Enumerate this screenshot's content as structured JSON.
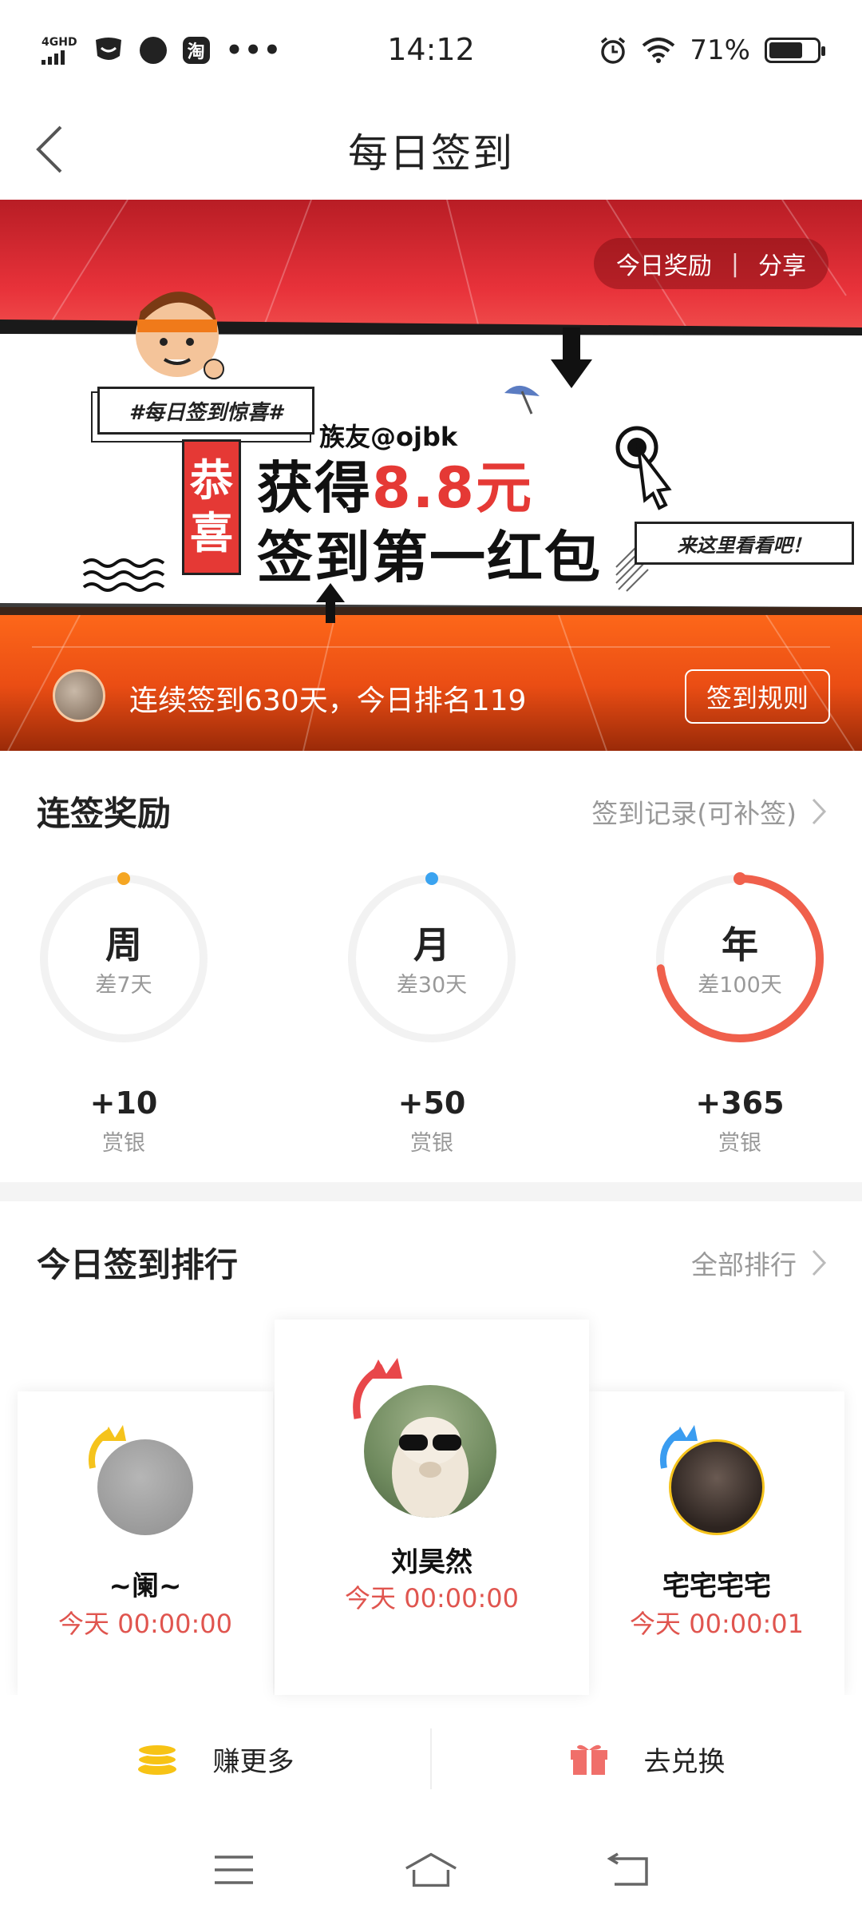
{
  "status_bar": {
    "network": "4GHD",
    "app_icon_text": "淘",
    "more": "•••",
    "time": "14:12",
    "battery": "71%",
    "battery_level": 0.71
  },
  "header": {
    "title": "每日签到"
  },
  "banner": {
    "reward_pill": {
      "today_reward": "今日奖励",
      "separator": "|",
      "share": "分享"
    },
    "tag": "#每日签到惊喜#",
    "congrats_chars": [
      "恭",
      "喜"
    ],
    "user": "族友@ojbk",
    "line1_prefix": "获得",
    "line1_amount": "8.8元",
    "line2": "签到第一红包",
    "come_see": "来这里看看吧！",
    "streak_text": "连续签到630天，今日排名119",
    "rules_button": "签到规则"
  },
  "streak_rewards": {
    "title": "连签奖励",
    "record_link": "签到记录(可补签)",
    "items": [
      {
        "label": "周",
        "remaining": "差7天",
        "reward": "+10",
        "unit": "赏银",
        "progress": 0.0,
        "dot_color": "#f5a623"
      },
      {
        "label": "月",
        "remaining": "差30天",
        "reward": "+50",
        "unit": "赏银",
        "progress": 0.0,
        "dot_color": "#3aa3f0"
      },
      {
        "label": "年",
        "remaining": "差100天",
        "reward": "+365",
        "unit": "赏银",
        "progress": 0.73,
        "dot_color": "#f0604c"
      }
    ]
  },
  "ranking": {
    "title": "今日签到排行",
    "all_link": "全部排行",
    "entries": [
      {
        "name": "刘昊然",
        "time": "今天 00:00:00",
        "crown_color": "#e8474a"
      },
      {
        "name": "~阑~",
        "time": "今天 00:00:00",
        "crown_color": "#f5c31c"
      },
      {
        "name": "宅宅宅宅",
        "time": "今天 00:00:01",
        "crown_color": "#3a9cf0"
      }
    ]
  },
  "bottom_actions": {
    "earn_more": "赚更多",
    "exchange": "去兑换"
  }
}
